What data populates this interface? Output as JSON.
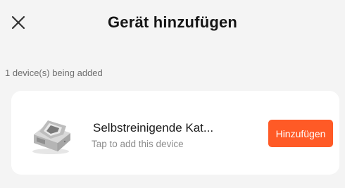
{
  "header": {
    "title": "Gerät hinzufügen",
    "close_icon": "close-icon"
  },
  "status": {
    "count_text": "1 device(s) being added"
  },
  "device": {
    "name": "Selbstreinigende Kat...",
    "hint": "Tap to add this device",
    "image_icon": "self-cleaning-litter-box-image",
    "add_label": "Hinzufügen"
  },
  "colors": {
    "accent": "#ff5a26",
    "background": "#f4f4f4",
    "card": "#ffffff"
  }
}
